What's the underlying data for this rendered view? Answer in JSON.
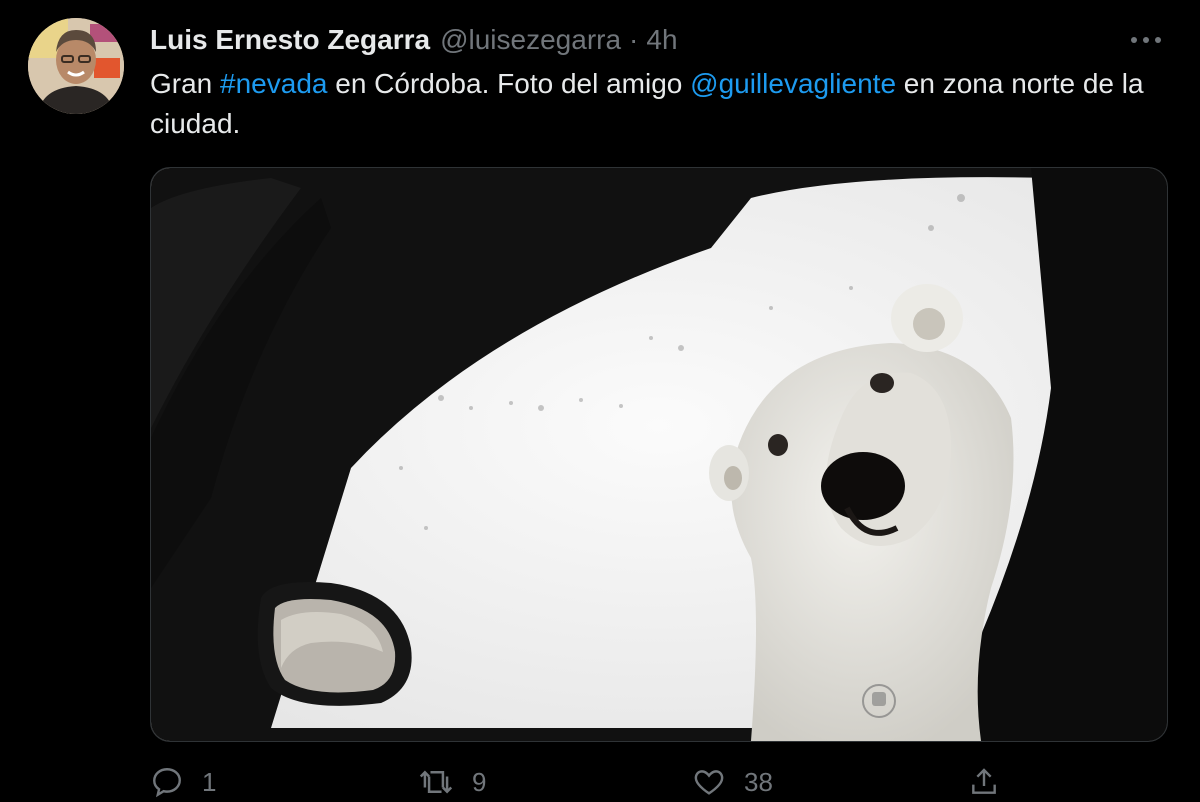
{
  "tweet": {
    "author": {
      "display_name": "Luis Ernesto Zegarra",
      "handle": "@luisezegarra",
      "time": "4h"
    },
    "separator": "·",
    "text": {
      "part1": "Gran ",
      "hashtag": "#nevada",
      "part2": " en Córdoba. Foto del amigo ",
      "mention": "@guillevagliente",
      "part3": " en zona norte de la ciudad."
    },
    "media": {
      "description_icon": "polar-bear-photo"
    },
    "actions": {
      "reply_count": "1",
      "retweet_count": "9",
      "like_count": "38"
    }
  },
  "colors": {
    "background": "#000000",
    "text": "#e7e9ea",
    "secondary_text": "#71767b",
    "link": "#1d9bf0"
  }
}
